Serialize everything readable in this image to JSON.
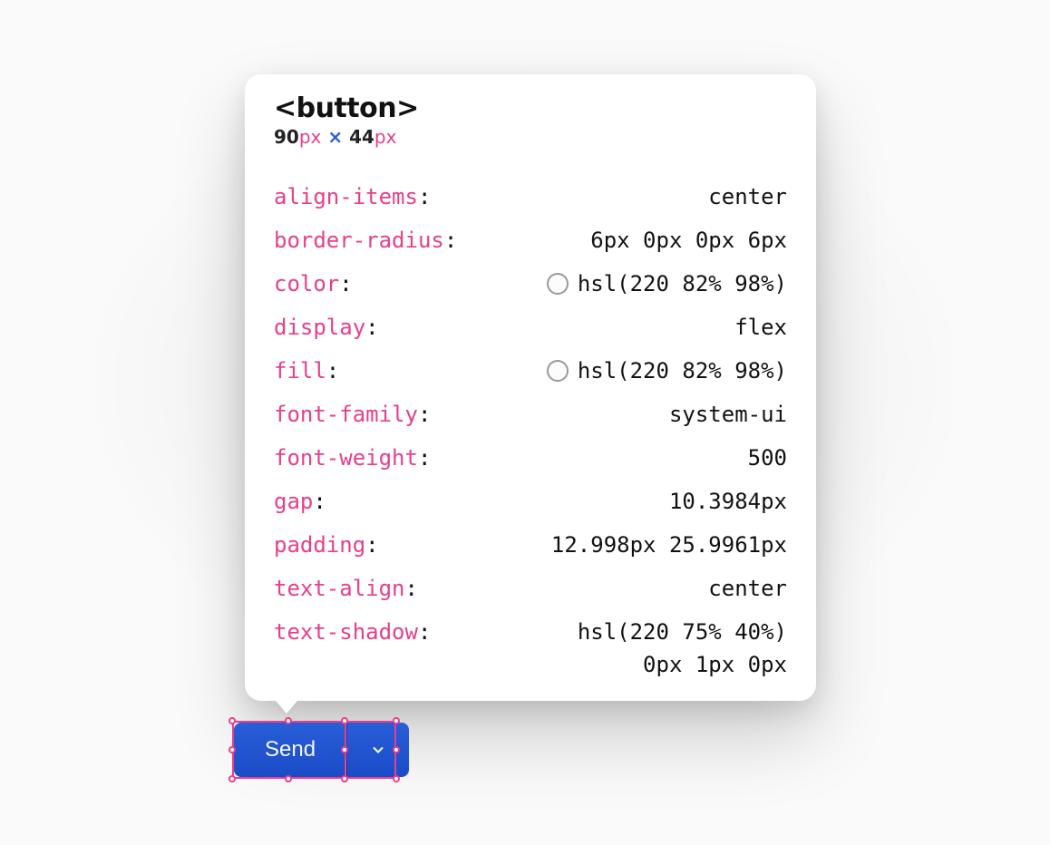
{
  "tooltip": {
    "tag": "<button>",
    "dims": {
      "w": "90",
      "h": "44",
      "unit": "px"
    },
    "props": [
      {
        "name": "align-items",
        "value": "center",
        "swatch": false
      },
      {
        "name": "border-radius",
        "value": "6px 0px 0px 6px",
        "swatch": false
      },
      {
        "name": "color",
        "value": "hsl(220 82% 98%)",
        "swatch": true
      },
      {
        "name": "display",
        "value": "flex",
        "swatch": false
      },
      {
        "name": "fill",
        "value": "hsl(220 82% 98%)",
        "swatch": true
      },
      {
        "name": "font-family",
        "value": "system-ui",
        "swatch": false
      },
      {
        "name": "font-weight",
        "value": "500",
        "swatch": false
      },
      {
        "name": "gap",
        "value": "10.3984px",
        "swatch": false
      },
      {
        "name": "padding",
        "value": "12.998px 25.9961px",
        "swatch": false
      },
      {
        "name": "text-align",
        "value": "center",
        "swatch": false
      },
      {
        "name": "text-shadow",
        "value": "hsl(220 75% 40%)",
        "value2": "0px 1px 0px",
        "swatch": false
      }
    ]
  },
  "button": {
    "label": "Send"
  }
}
